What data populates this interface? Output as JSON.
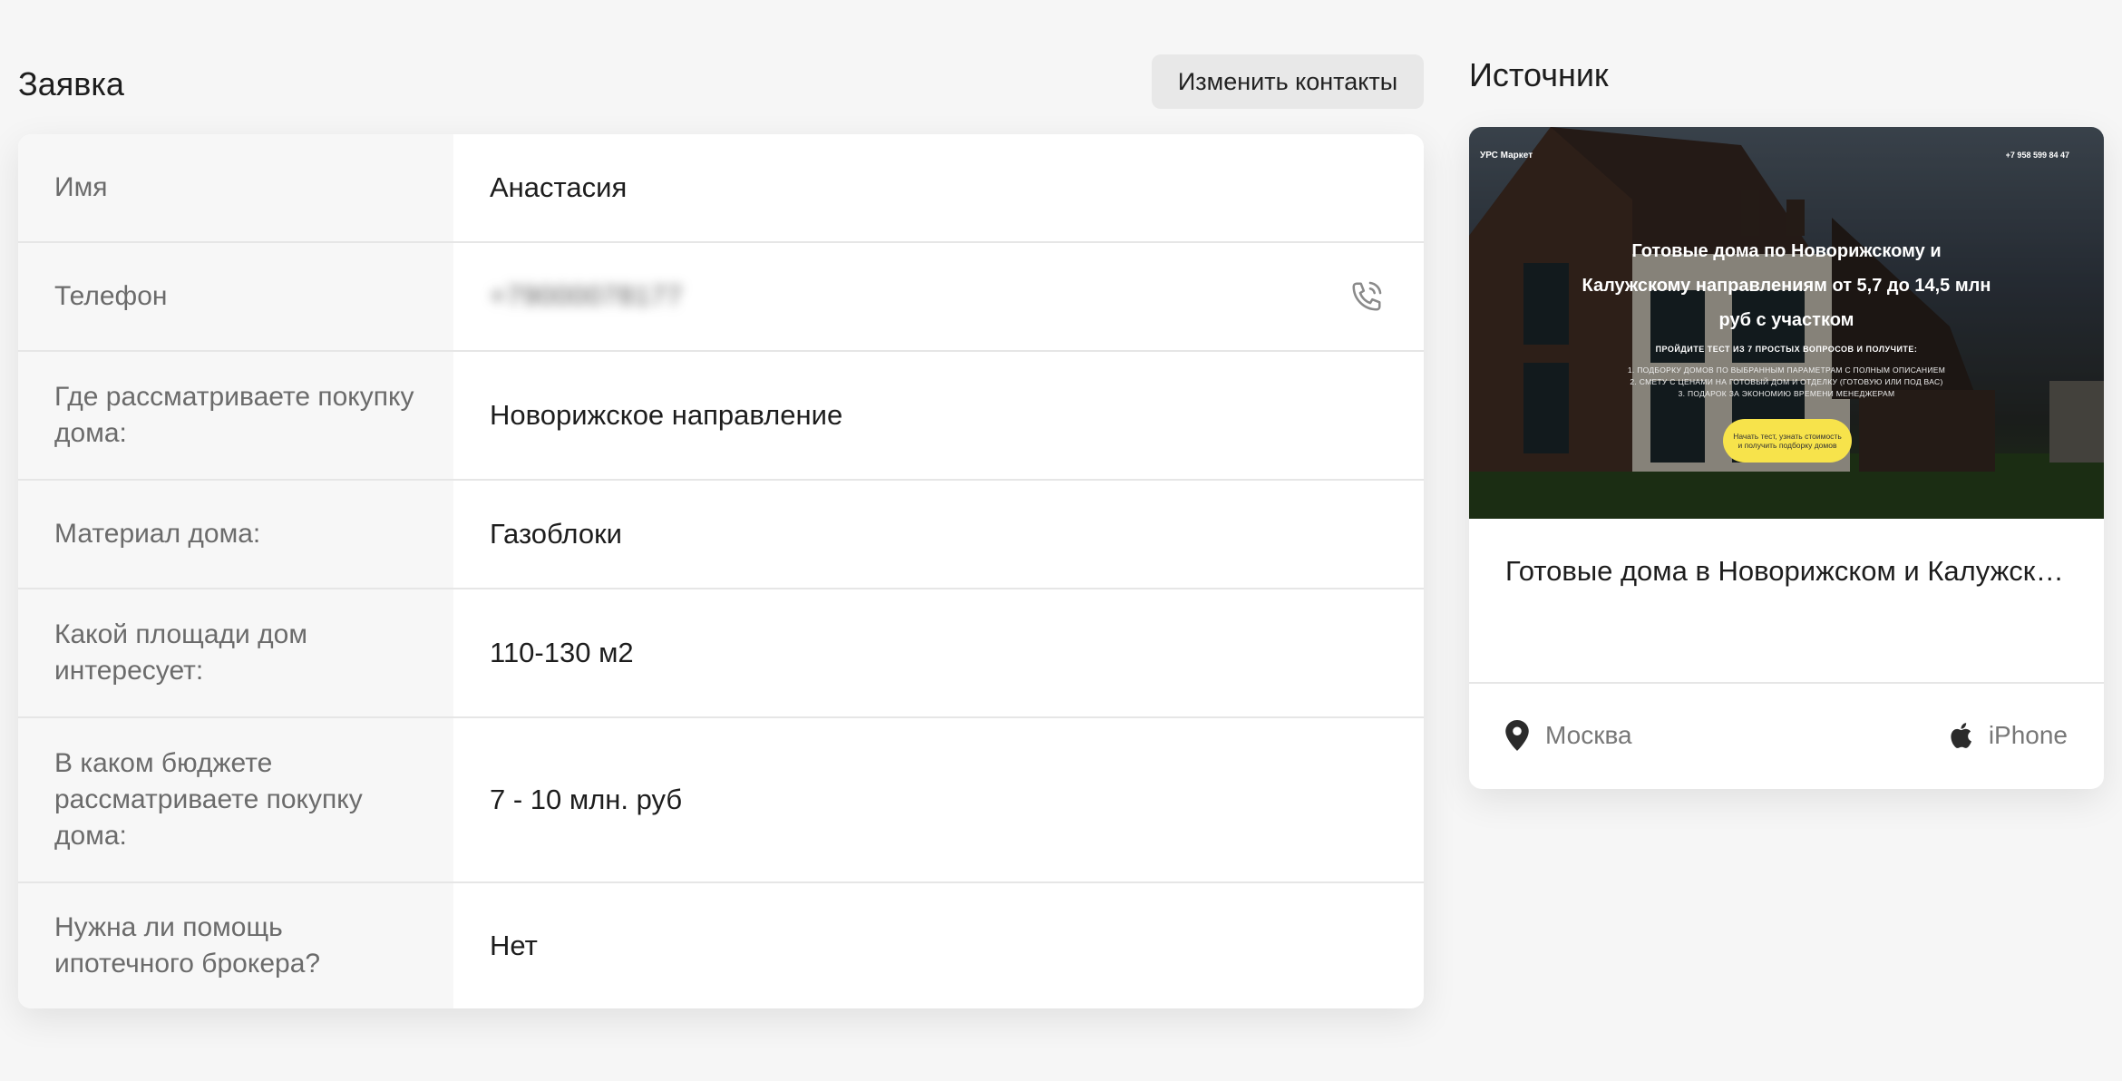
{
  "request": {
    "title": "Заявка",
    "edit_contacts_label": "Изменить контакты",
    "rows": [
      {
        "label": "Имя",
        "value": "Анастасия"
      },
      {
        "label": "Телефон",
        "value": "+79000078177"
      },
      {
        "label": "Где рассматриваете покупку дома:",
        "value": "Новорижское направление"
      },
      {
        "label": "Материал дома:",
        "value": "Газоблоки"
      },
      {
        "label": "Какой площади дом интересует:",
        "value": "110-130 м2"
      },
      {
        "label": "В каком бюджете рассматриваете покупку дома:",
        "value": "7 - 10 млн. руб"
      },
      {
        "label": "Нужна ли помощь ипотечного брокера?",
        "value": "Нет"
      }
    ]
  },
  "source": {
    "title": "Источник",
    "preview": {
      "logo": "УРС Маркет",
      "phone": "+7 958 599 84 47",
      "headline": "Готовые дома по Новорижскому и Калужскому направлениям от 5,7 до 14,5 млн руб с участком",
      "subheading": "ПРОЙДИТЕ ТЕСТ ИЗ 7 ПРОСТЫХ ВОПРОСОВ И ПОЛУЧИТЕ:",
      "list": [
        "1. ПОДБОРКУ ДОМОВ ПО ВЫБРАННЫМ ПАРАМЕТРАМ С ПОЛНЫМ ОПИСАНИЕМ",
        "2. СМЕТУ С ЦЕНАМИ НА ГОТОВЫЙ ДОМ И ОТДЕЛКУ (ГОТОВУЮ ИЛИ ПОД ВАС)",
        "3. ПОДАРОК ЗА ЭКОНОМИЮ ВРЕМЕНИ МЕНЕДЖЕРАМ"
      ],
      "cta": "Начать тест, узнать стоимость и получить подборку домов"
    },
    "card_title": "Готовые дома в Новорижском и Калужском направлениях",
    "city": "Москва",
    "device": "iPhone"
  }
}
